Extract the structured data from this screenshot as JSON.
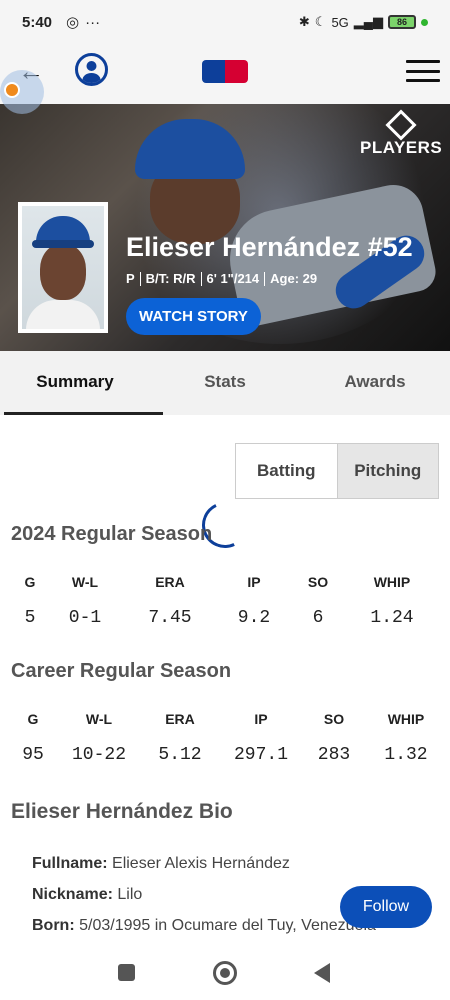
{
  "status_bar": {
    "time": "5:40",
    "battery": "86",
    "network": "5G"
  },
  "hero": {
    "players_logo_text": "PLAYERS",
    "name": "Elieser Hernández #52",
    "position": "P",
    "bats_throws": "B/T: R/R",
    "height_weight": "6' 1\"/214",
    "age": "Age: 29",
    "watch_button": "WATCH STORY"
  },
  "tabs": [
    "Summary",
    "Stats",
    "Awards"
  ],
  "toggle": {
    "batting": "Batting",
    "pitching": "Pitching"
  },
  "season": {
    "title": "2024 Regular Season",
    "headers": [
      "G",
      "W-L",
      "ERA",
      "IP",
      "SO",
      "WHIP"
    ],
    "values": [
      "5",
      "0-1",
      "7.45",
      "9.2",
      "6",
      "1.24"
    ]
  },
  "career": {
    "title": "Career Regular Season",
    "headers": [
      "G",
      "W-L",
      "ERA",
      "IP",
      "SO",
      "WHIP"
    ],
    "values": [
      "95",
      "10-22",
      "5.12",
      "297.1",
      "283",
      "1.32"
    ]
  },
  "bio": {
    "title": "Elieser Hernández Bio",
    "fullname_label": "Fullname:",
    "fullname": "Elieser Alexis Hernández",
    "nickname_label": "Nickname:",
    "nickname": "Lilo",
    "born_label": "Born:",
    "born": "5/03/1995 in Ocumare del Tuy, Venezuela"
  },
  "follow_button": "Follow"
}
